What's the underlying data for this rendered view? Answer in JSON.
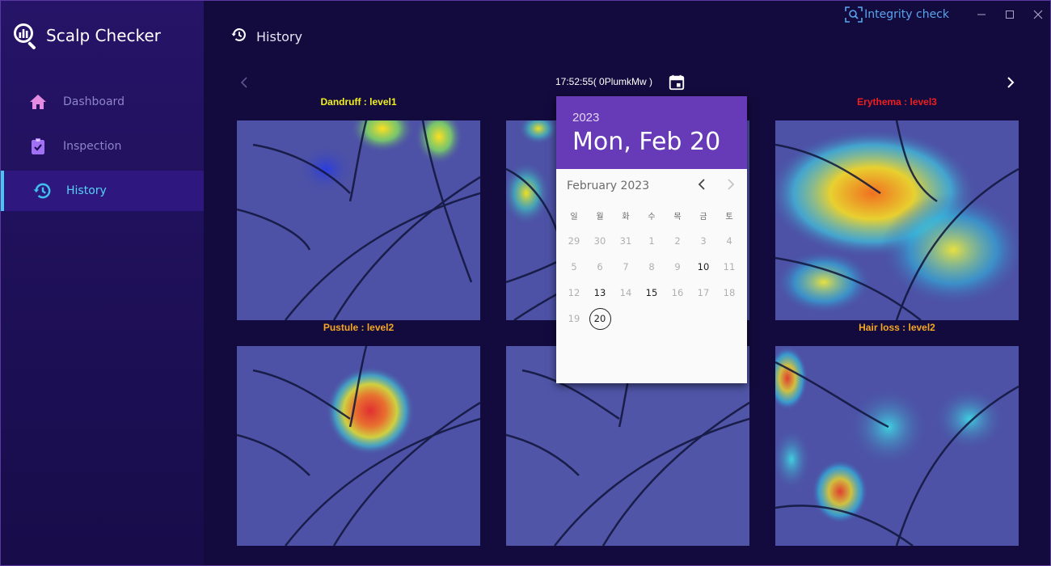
{
  "app": {
    "title": "Scalp Checker"
  },
  "sidebar": {
    "items": [
      {
        "label": "Dashboard",
        "icon": "home-icon",
        "color": "#e48ae0"
      },
      {
        "label": "Inspection",
        "icon": "clipboard-check-icon",
        "color": "#a070f5"
      },
      {
        "label": "History",
        "icon": "history-icon",
        "color": "#3fc0ee",
        "active": true
      }
    ]
  },
  "header": {
    "title": "History",
    "integrity_label": "Integrity check"
  },
  "viewer": {
    "timestamp": "17:52:55( 0PlumkMw )",
    "cells": [
      {
        "label": "Dandruff : level1",
        "color": "#f0f01e"
      },
      {
        "label": "",
        "color": "#ffffff"
      },
      {
        "label": "Erythema : level3",
        "color": "#f01e1e"
      },
      {
        "label": "Pustule : level2",
        "color": "#f5a623"
      },
      {
        "label": "",
        "color": "#ffffff"
      },
      {
        "label": "Hair loss : level2",
        "color": "#f5a623"
      }
    ]
  },
  "datepicker": {
    "year": "2023",
    "date": "Mon, Feb 20",
    "month_label": "February 2023",
    "weekdays": [
      "일",
      "월",
      "화",
      "수",
      "목",
      "금",
      "토"
    ],
    "weeks": [
      [
        "29",
        "30",
        "31",
        "1",
        "2",
        "3",
        "4"
      ],
      [
        "5",
        "6",
        "7",
        "8",
        "9",
        "10",
        "11"
      ],
      [
        "12",
        "13",
        "14",
        "15",
        "16",
        "17",
        "18"
      ],
      [
        "19",
        "20",
        "",
        "",
        "",
        "",
        ""
      ]
    ],
    "available_days": [
      "10",
      "13",
      "15"
    ],
    "selected_day": "20",
    "accent": "#673ab7"
  },
  "colors": {
    "accent": "#45c6f0",
    "brand_bg": "#261468"
  }
}
